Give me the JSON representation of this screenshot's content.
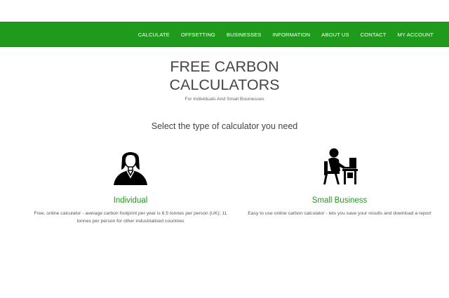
{
  "nav": {
    "items": [
      "CALCULATE",
      "OFFSETTING",
      "BUSINESSES",
      "INFORMATION",
      "ABOUT US",
      "CONTACT",
      "MY ACCOUNT"
    ]
  },
  "hero": {
    "title_line1": "FREE CARBON",
    "title_line2": "CALCULATORS",
    "subtitle": "For Individuals And Small Businesses"
  },
  "select_heading": "Select the type of calculator you need",
  "calculators": [
    {
      "icon": "person-icon",
      "title": "Individual",
      "description": "Free, online calculator - average carbon footprint per year is 6.5 tonnes per person (UK); 11 tonnes per person for other industrialised countries"
    },
    {
      "icon": "office-worker-icon",
      "title": "Small Business",
      "description": "Easy to use online carbon calculator - lets you save your results and download a report"
    }
  ],
  "colors": {
    "brand_green": "#1f9a1c",
    "text_dark": "#444444"
  }
}
